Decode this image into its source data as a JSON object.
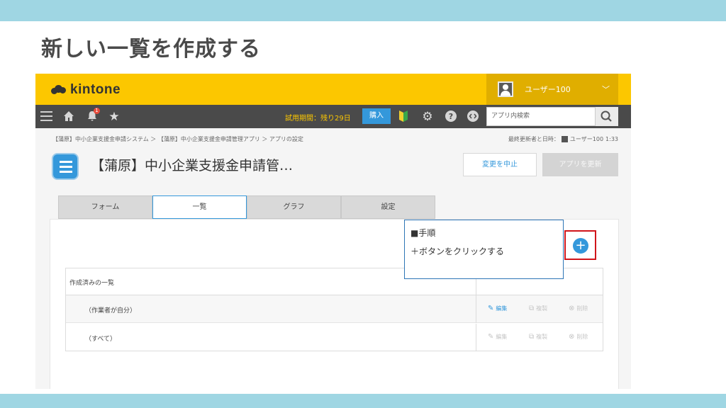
{
  "slide": {
    "title": "新しい一覧を作成する"
  },
  "app_header": {
    "logo_text": "kintone",
    "user_name": "ユーザー100",
    "notification_count": "1",
    "trial_text": "試用期間：残り29日",
    "buy_label": "購入",
    "search_placeholder": "アプリ内検索"
  },
  "breadcrumb": "【蒲原】中小企業支援金申請システム ＞ 【蒲原】中小企業支援金申請管理アプリ ＞ アプリの設定",
  "last_updated": {
    "label": "最終更新者と日時：",
    "user": "ユーザー100",
    "time": "1:33"
  },
  "app": {
    "name": "【蒲原】中小企業支援金申請管…",
    "cancel_label": "変更を中止",
    "update_label": "アプリを更新"
  },
  "tabs": [
    {
      "label": "フォーム"
    },
    {
      "label": "一覧"
    },
    {
      "label": "グラフ"
    },
    {
      "label": "設定"
    }
  ],
  "views_table": {
    "header": "作成済みの一覧",
    "rows": [
      {
        "name": "（作業者が自分）",
        "edit": "編集",
        "copy": "複製",
        "delete": "削除"
      },
      {
        "name": "（すべて）",
        "edit": "編集",
        "copy": "複製",
        "delete": "削除"
      }
    ]
  },
  "callout": {
    "heading": "■手順",
    "body": "＋ボタンをクリックする"
  },
  "colors": {
    "band": "#9fd6e3",
    "header_yellow": "#fcc700",
    "nav_dark": "#4a4a4a",
    "accent_blue": "#3498db",
    "highlight_red": "#d0141a"
  }
}
